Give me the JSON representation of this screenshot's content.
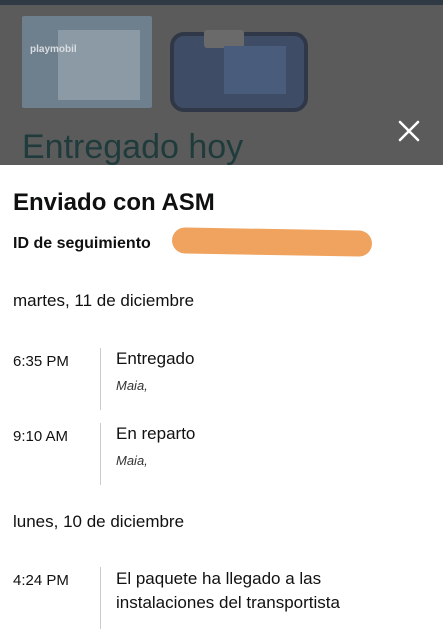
{
  "background": {
    "toy_brand": "playmobil",
    "headline": "Entregado hoy"
  },
  "sheet": {
    "title": "Enviado con ASM",
    "tracking_label": "ID de seguimiento",
    "days": [
      {
        "date": "martes, 11 de diciembre",
        "events": [
          {
            "time": "6:35 PM",
            "status": "Entregado",
            "location": "Maia,"
          },
          {
            "time": "9:10 AM",
            "status": "En reparto",
            "location": "Maia,"
          }
        ]
      },
      {
        "date": "lunes, 10 de diciembre",
        "events": [
          {
            "time": "4:24 PM",
            "status_line1": "El paquete ha llegado a las",
            "status_line2": "instalaciones del transportista"
          }
        ]
      }
    ]
  },
  "icons": {
    "close": "close-icon"
  },
  "colors": {
    "redaction": "#f0a35e",
    "overlay": "#5b5b5b",
    "divider": "#c9cccc"
  }
}
